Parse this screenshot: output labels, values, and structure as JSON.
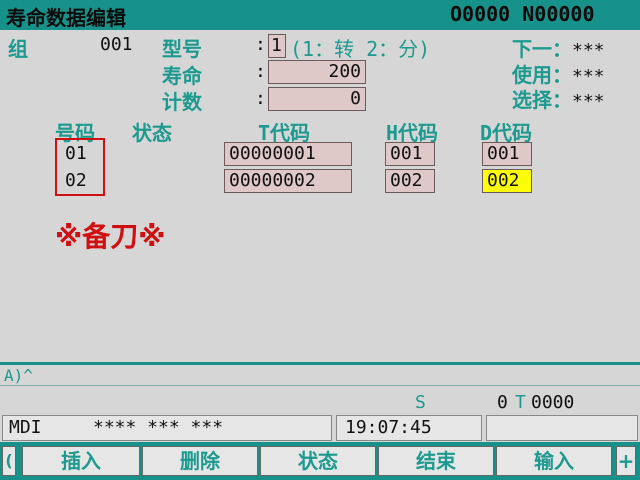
{
  "title": "寿命数据编辑",
  "program": "O0000 N00000",
  "group": {
    "label": "组",
    "value": "001"
  },
  "type": {
    "label": "型号",
    "value": "1",
    "hint": "(1：转 2：分)"
  },
  "life": {
    "label": "寿命",
    "value": "200"
  },
  "count": {
    "label": "计数",
    "value": "0"
  },
  "right_status": [
    {
      "label": "下一：",
      "value": "***"
    },
    {
      "label": "使用：",
      "value": "***"
    },
    {
      "label": "选择：",
      "value": "***"
    }
  ],
  "table": {
    "headers": [
      "号码",
      "状态",
      "T代码",
      "H代码",
      "D代码"
    ],
    "rows": [
      {
        "no": "01",
        "t": "00000001",
        "h": "001",
        "d": "001"
      },
      {
        "no": "02",
        "t": "00000002",
        "h": "002",
        "d": "002"
      }
    ]
  },
  "spare_note": "※备刀※",
  "input_line": "A)^",
  "spindle": {
    "s_label": "S",
    "s_value": "0",
    "t_label": "T",
    "t_value": "0000"
  },
  "status_bar": {
    "mode": "MDI",
    "flags": "**** *** ***",
    "time": "19:07:45"
  },
  "softkeys": [
    "插入",
    "删除",
    "状态",
    "结束",
    "输入"
  ],
  "softkey_left": "(",
  "softkey_right": "+",
  "colors": {
    "bar": "#17928a",
    "label": "#1c9a8f",
    "field": "#dfc8c8",
    "highlight": "#ffff00",
    "alert": "#d01010"
  }
}
